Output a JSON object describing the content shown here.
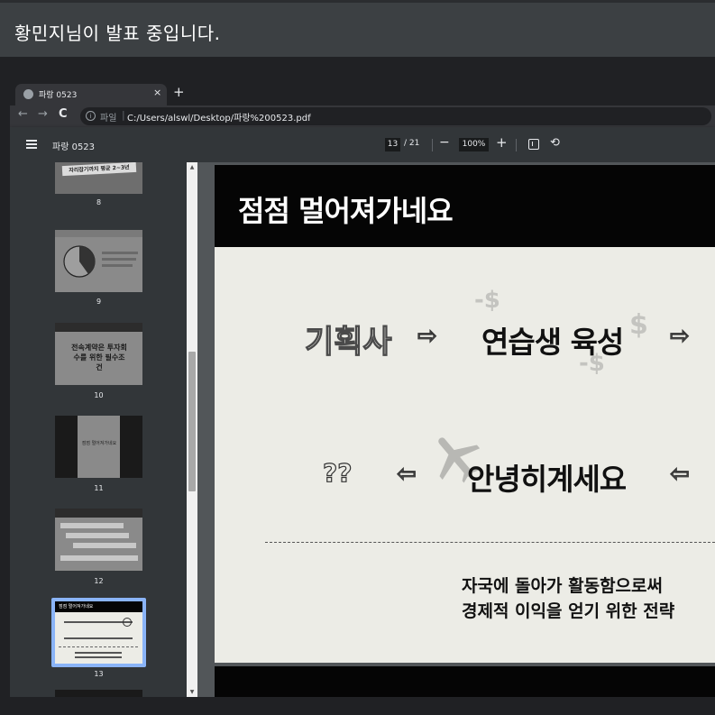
{
  "banner": {
    "text": "황민지님이 발표 중입니다."
  },
  "browser": {
    "tab_title": "파랑 0523",
    "tab_close": "×",
    "new_tab": "+",
    "nav_back": "←",
    "nav_forward": "→",
    "nav_reload": "C",
    "site_label": "파일",
    "url": "C:/Users/alswl/Desktop/파랑%200523.pdf"
  },
  "pdf": {
    "doc_title": "파랑 0523",
    "current_page": "13",
    "page_total": "/ 21",
    "zoom_out": "−",
    "zoom": "100%",
    "zoom_in": "+",
    "rotate": "⟲"
  },
  "thumbnails": [
    {
      "num": "8",
      "text": "자리잡기까지 평균 2~3년"
    },
    {
      "num": "9",
      "text": ""
    },
    {
      "num": "10",
      "text": "전속계약은 투자회수를 위한 필수조건"
    },
    {
      "num": "11",
      "text": "점점 멀어져가네요"
    },
    {
      "num": "12",
      "text": ""
    },
    {
      "num": "13",
      "text": "점점 멀어져가네요"
    }
  ],
  "slide": {
    "title": "점점 멀어져가네요",
    "agency": "기획사",
    "trainee": "연습생 육성",
    "goodbye": "안녕히계세요",
    "question": "??",
    "caption_line1": "자국에 돌아가 활동함으로써",
    "caption_line2": "경제적 이익을 얻기 위한 전략",
    "money_minus": "-$",
    "money": "$"
  }
}
